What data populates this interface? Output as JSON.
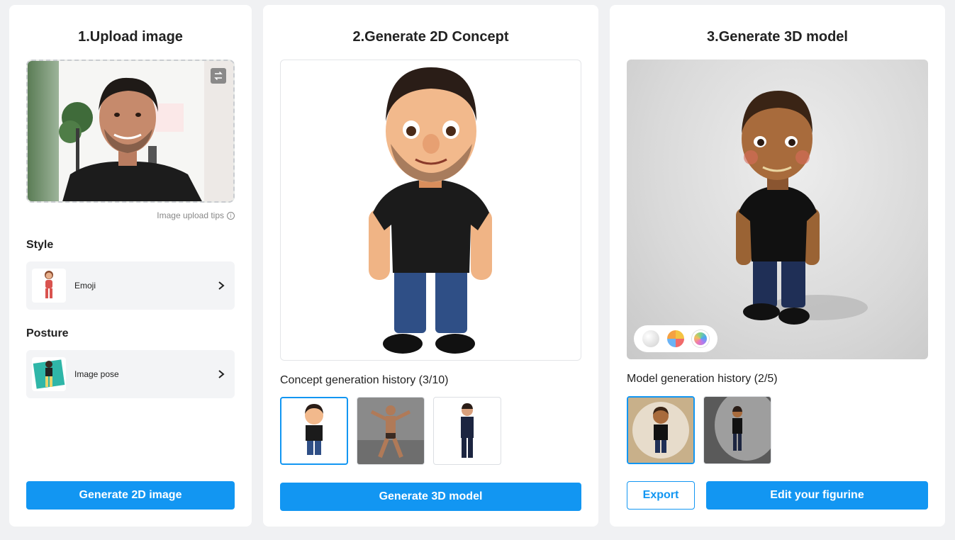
{
  "step1": {
    "title": "1.Upload image",
    "upload_tips": "Image upload tips",
    "style_label": "Style",
    "style_value": "Emoji",
    "posture_label": "Posture",
    "posture_value": "Image pose",
    "generate_button": "Generate 2D image"
  },
  "step2": {
    "title": "2.Generate 2D Concept",
    "history_label": "Concept generation history (3/10)",
    "generate_button": "Generate 3D model"
  },
  "step3": {
    "title": "3.Generate 3D model",
    "history_label": "Model generation history (2/5)",
    "export_button": "Export",
    "edit_button": "Edit your figurine"
  },
  "colors": {
    "accent": "#1296f2",
    "panel_bg": "#ffffff",
    "page_bg": "#f0f1f3"
  },
  "icons": {
    "swap": "swap-icon",
    "info": "info-icon",
    "chevron": "chevron-right-icon"
  }
}
